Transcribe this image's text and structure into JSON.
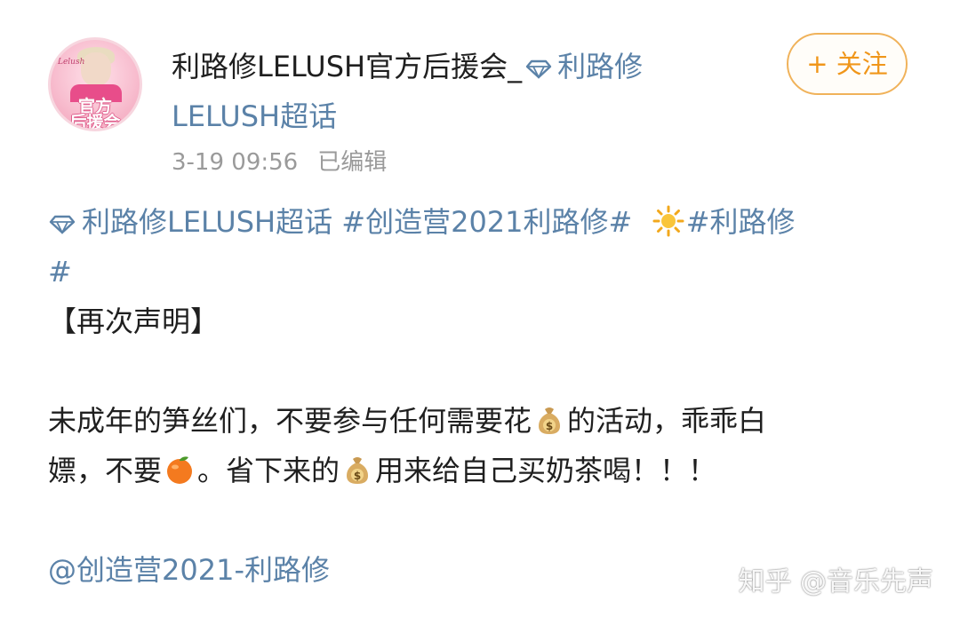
{
  "user": {
    "name": "利路修LELUSH官方后援会_",
    "supertopic": "利路修",
    "supertopic_line2": "LELUSH超话",
    "avatar_signature": "Lelush",
    "avatar_text_line1": "官方",
    "avatar_text_line2": "后援会"
  },
  "follow_button": {
    "label": "+ 关注"
  },
  "meta": {
    "time": "3-19 09:56",
    "edited": "已编辑"
  },
  "post": {
    "tag_supertopic": "利路修LELUSH超话",
    "tag_2": "#创造营2021利路修#",
    "tag_3_a": "#利路修",
    "tag_3_b": "#",
    "heading": "【再次声明】",
    "para1_a": "未成年的笋丝们，不要参与任何需要花",
    "para1_b": "的活动，乖乖白",
    "para1_c": "嫖，不要",
    "para1_d": "。省下来的",
    "para1_e": "用来给自己买奶茶喝！！！",
    "mention": "@创造营2021-利路修"
  },
  "icons": {
    "diamond": "diamond-icon",
    "sun": "sun-emoji",
    "money_bag": "money-bag-emoji",
    "tangerine": "tangerine-emoji"
  },
  "colors": {
    "link": "#5b82a8",
    "follow": "#f0961a",
    "meta": "#9a9a9a"
  },
  "watermark": "知乎 @音乐先声"
}
